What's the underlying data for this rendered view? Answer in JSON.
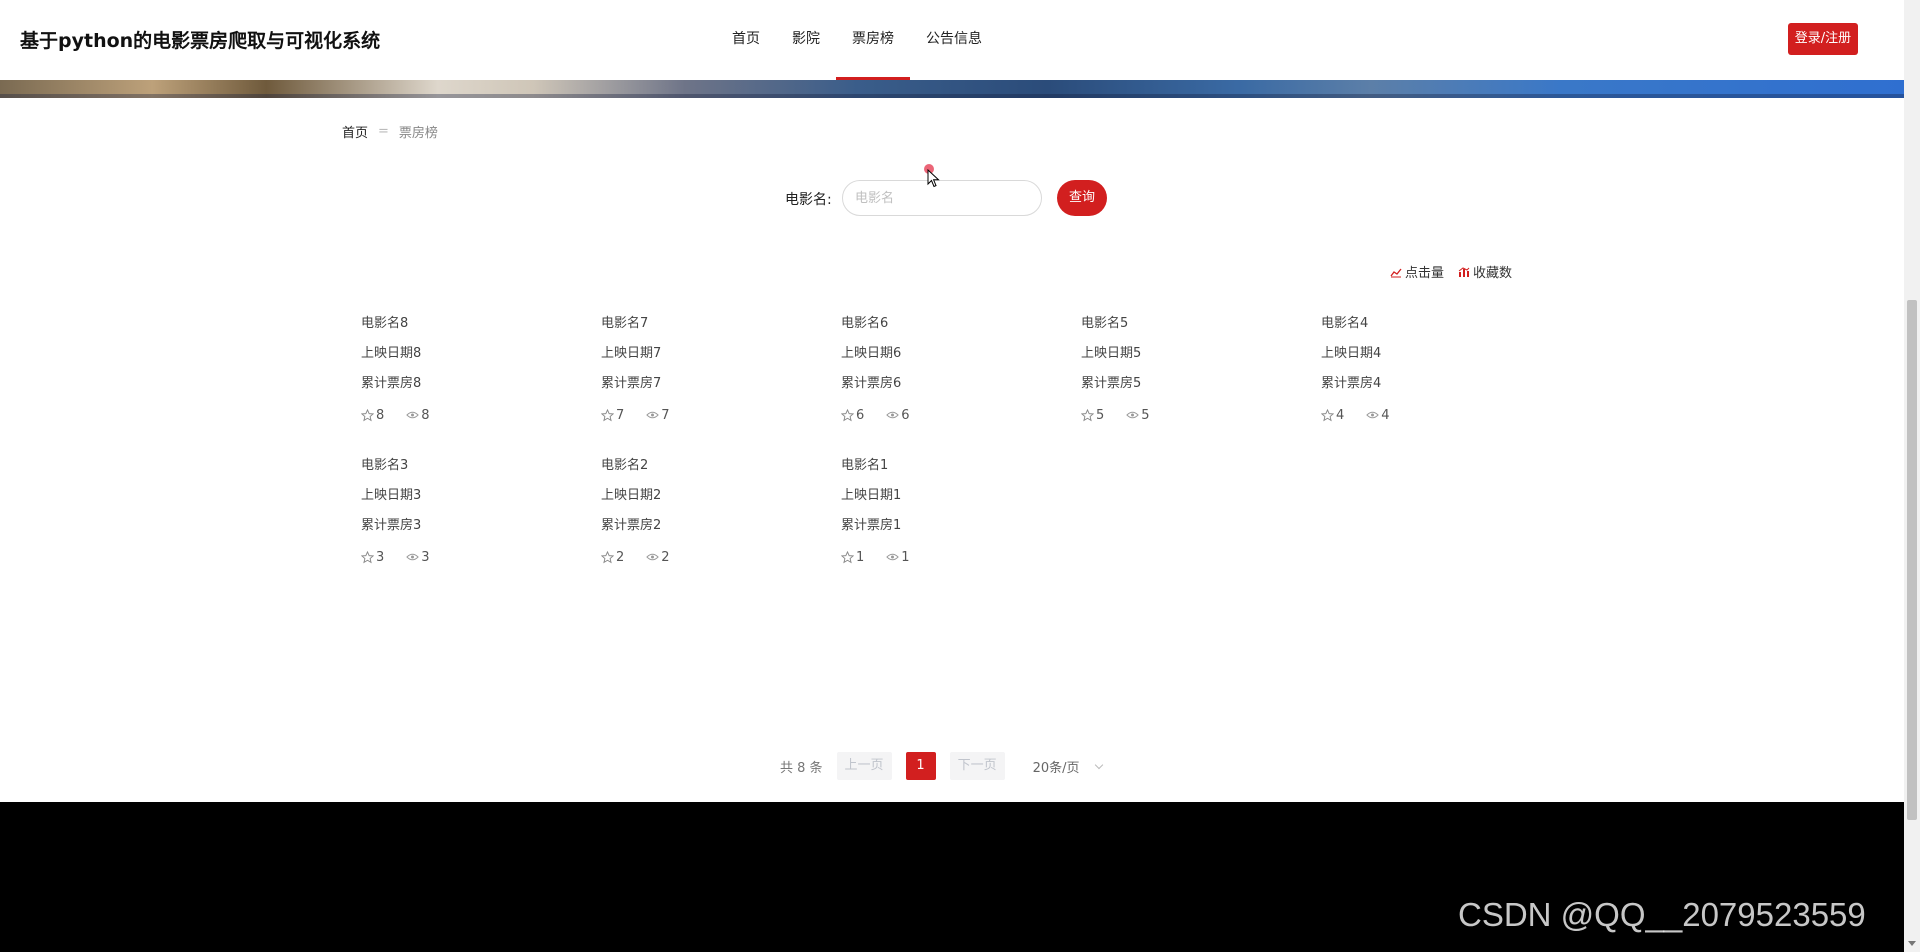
{
  "header": {
    "site_title": "基于python的电影票房爬取与可视化系统",
    "nav": [
      {
        "label": "首页",
        "active": false
      },
      {
        "label": "影院",
        "active": false
      },
      {
        "label": "票房榜",
        "active": true
      },
      {
        "label": "公告信息",
        "active": false
      }
    ],
    "login_label": "登录/注册"
  },
  "breadcrumb": {
    "home": "首页",
    "separator": "=",
    "current": "票房榜"
  },
  "search": {
    "label": "电影名:",
    "placeholder": "电影名",
    "value": "",
    "button_label": "查询"
  },
  "sort": {
    "clicks_label": "点击量",
    "favorites_label": "收藏数"
  },
  "movies": [
    {
      "name": "电影名8",
      "date": "上映日期8",
      "box_office": "累计票房8",
      "favorites": "8",
      "views": "8"
    },
    {
      "name": "电影名7",
      "date": "上映日期7",
      "box_office": "累计票房7",
      "favorites": "7",
      "views": "7"
    },
    {
      "name": "电影名6",
      "date": "上映日期6",
      "box_office": "累计票房6",
      "favorites": "6",
      "views": "6"
    },
    {
      "name": "电影名5",
      "date": "上映日期5",
      "box_office": "累计票房5",
      "favorites": "5",
      "views": "5"
    },
    {
      "name": "电影名4",
      "date": "上映日期4",
      "box_office": "累计票房4",
      "favorites": "4",
      "views": "4"
    },
    {
      "name": "电影名3",
      "date": "上映日期3",
      "box_office": "累计票房3",
      "favorites": "3",
      "views": "3"
    },
    {
      "name": "电影名2",
      "date": "上映日期2",
      "box_office": "累计票房2",
      "favorites": "2",
      "views": "2"
    },
    {
      "name": "电影名1",
      "date": "上映日期1",
      "box_office": "累计票房1",
      "favorites": "1",
      "views": "1"
    }
  ],
  "pagination": {
    "total": "共 8 条",
    "prev_label": "上一页",
    "current_page": "1",
    "next_label": "下一页",
    "page_size": "20条/页"
  },
  "watermark": "CSDN @QQ__2079523559",
  "colors": {
    "accent": "#d21f1f",
    "footer": "#000000"
  },
  "icons": {
    "favorite": "star-icon",
    "views": "eye-icon",
    "clicks_sort": "trend-line-icon",
    "favorites_sort": "bar-chart-icon"
  }
}
